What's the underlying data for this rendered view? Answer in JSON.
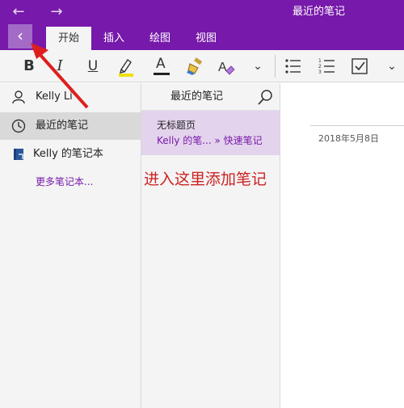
{
  "window": {
    "title": "最近的笔记",
    "back_arrow": "←",
    "forward_arrow": "→"
  },
  "ribbon": {
    "back_glyph": "‹",
    "tabs": [
      {
        "label": "开始",
        "active": true
      },
      {
        "label": "插入"
      },
      {
        "label": "绘图"
      },
      {
        "label": "视图"
      }
    ]
  },
  "toolbar": {
    "bold": "B",
    "italic": "I",
    "underline": "U",
    "font_color": "A",
    "highlight_color": "#f0e000",
    "font_color_bar": "#222222",
    "more": "⌄"
  },
  "sidebar": {
    "account": "Kelly Li",
    "items": [
      {
        "label": "最近的笔记",
        "selected": true,
        "icon": "clock-icon"
      },
      {
        "label": "Kelly 的笔记本",
        "icon": "notebook-icon"
      }
    ],
    "more_notebooks": "更多笔记本..."
  },
  "pages": {
    "header": "最近的笔记",
    "items": [
      {
        "title": "无标题页",
        "path": "Kelly 的笔... » 快速笔记"
      }
    ]
  },
  "content": {
    "date": "2018年5月8日"
  },
  "annotation": {
    "text": "进入这里添加笔记",
    "color": "#cc2222"
  },
  "colors": {
    "accent": "#7719aa",
    "accent_light": "#a36bc6",
    "selected_page": "#e3d3ec"
  }
}
